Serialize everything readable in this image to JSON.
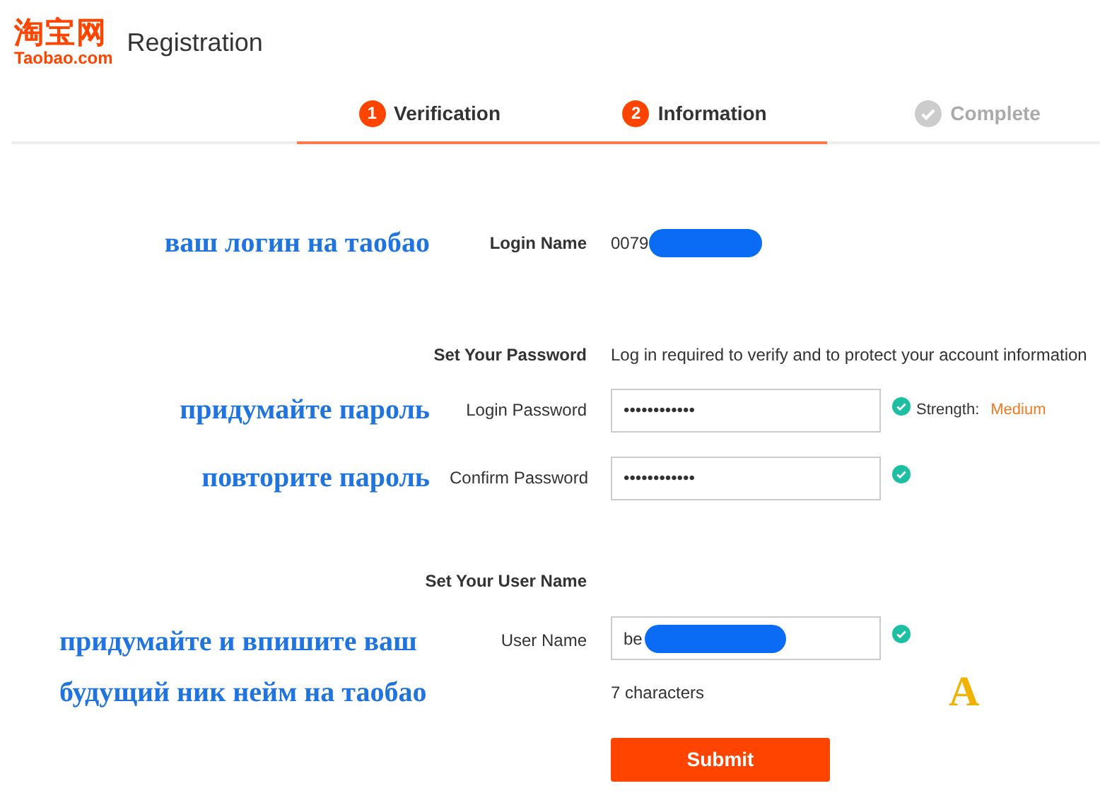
{
  "header": {
    "logo_cn": "淘宝网",
    "logo_en": "Taobao.com",
    "title": "Registration"
  },
  "steps": [
    {
      "number": "1",
      "label": "Verification",
      "reached": true
    },
    {
      "number": "2",
      "label": "Information",
      "reached": true
    },
    {
      "label": "Complete",
      "reached": false
    }
  ],
  "form": {
    "rows": [
      {
        "kind": "value",
        "annotation": "ваш логин на таобао",
        "label": "Login Name",
        "value": "0079",
        "redacted": true
      },
      {
        "kind": "section",
        "label": "Set Your Password",
        "note": "Log in required to verify and to protect your account information"
      },
      {
        "kind": "field",
        "annotation": "придумайте пароль",
        "label": "Login Password",
        "value": "••••••••••••",
        "valid": true,
        "strength_label": "Strength:",
        "strength": "Medium"
      },
      {
        "kind": "field",
        "annotation": "повторите пароль",
        "label": "Confirm Password",
        "value": "••••••••••••",
        "valid": true
      },
      {
        "kind": "section",
        "label": "Set Your User Name"
      },
      {
        "kind": "field",
        "annotation_lines": [
          "придумайте и впишите ваш",
          "будущий ник нейм на таобао"
        ],
        "label": "User Name",
        "value": "be",
        "redacted": true,
        "valid": true,
        "hint": "7 characters",
        "mark": "A"
      }
    ],
    "submit": "Submit"
  }
}
